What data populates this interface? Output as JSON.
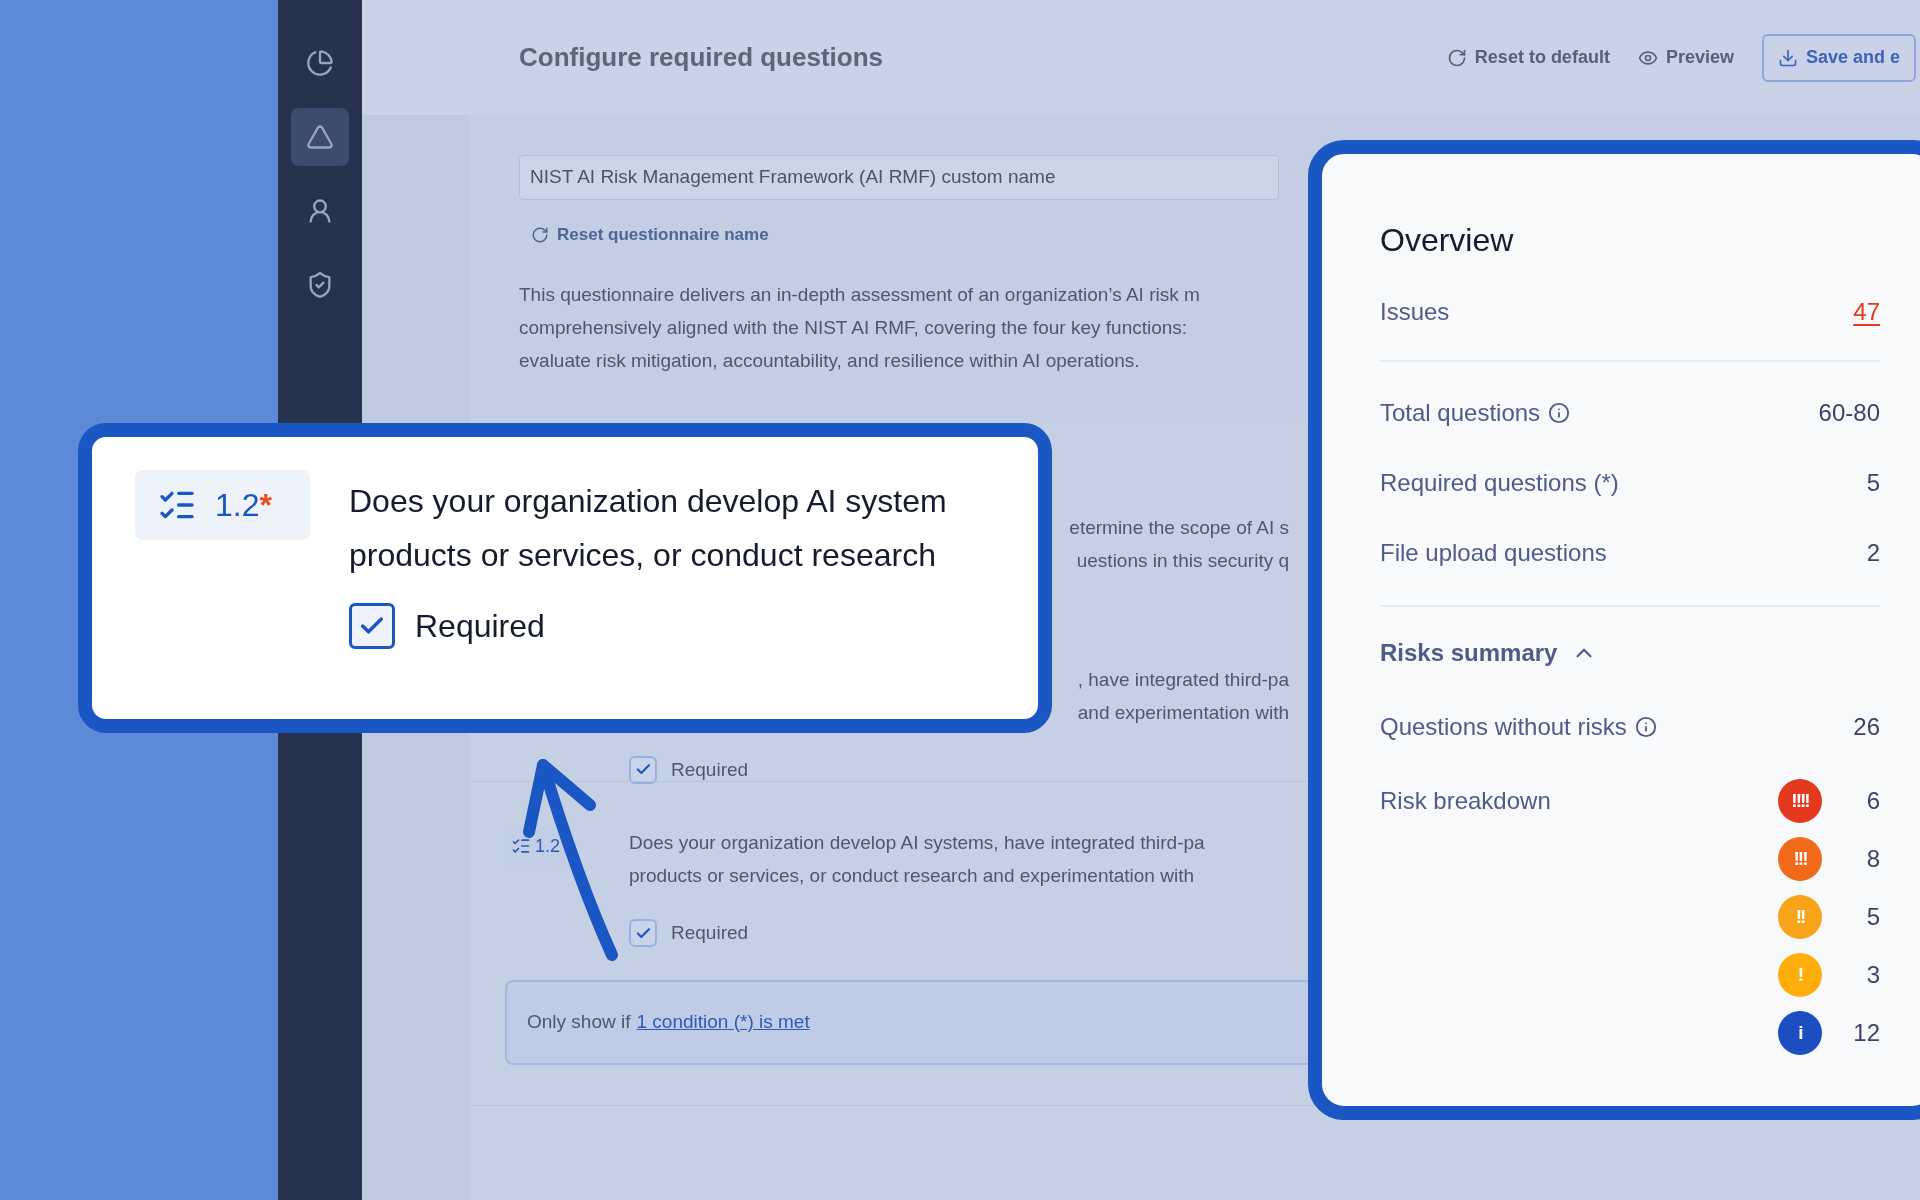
{
  "sidebar": {
    "items": [
      {
        "kind": "chart",
        "selected": false
      },
      {
        "kind": "triangle",
        "selected": true
      },
      {
        "kind": "person",
        "selected": false
      },
      {
        "kind": "shield",
        "selected": false
      }
    ]
  },
  "header": {
    "title": "Configure required questions",
    "actions": [
      {
        "kind": "reset",
        "label": "Reset to default"
      },
      {
        "kind": "preview",
        "label": "Preview"
      },
      {
        "kind": "save",
        "label": "Save and e"
      }
    ]
  },
  "form": {
    "name_field": {
      "value": "NIST AI Risk Management Framework (AI RMF) custom name"
    },
    "reset_link": "Reset questionnaire name",
    "description_lines": [
      "This questionnaire delivers an in-depth assessment of an organization’s AI risk m",
      "comprehensively aligned with the NIST AI RMF, covering the four key functions:",
      "evaluate risk mitigation, accountability, and resilience within AI operations."
    ]
  },
  "questions": [
    {
      "kind": "partial",
      "lines": [
        "etermine the scope of AI s",
        "uestions in this security q"
      ]
    },
    {
      "kind": "partial",
      "lines": [
        ", have integrated third-pa",
        "and experimentation with"
      ],
      "required": {
        "label": "Required",
        "checked": true
      }
    },
    {
      "kind": "full",
      "number": "1.2",
      "lines": [
        "Does your organization develop AI systems, have integrated third-pa",
        "products or services, or conduct research and experimentation with"
      ],
      "required": {
        "label": "Required",
        "checked": true
      }
    }
  ],
  "condition": {
    "prefix": "Only show if",
    "link": "1 condition (*) is met"
  },
  "callout": {
    "number": "1.2",
    "required_mark": "*",
    "lines": [
      "Does your organization develop AI system",
      "products or services, or conduct research"
    ],
    "required": {
      "label": "Required",
      "checked": true
    }
  },
  "overview": {
    "title": "Overview",
    "issues": {
      "label": "Issues",
      "value": "47"
    },
    "stats": [
      {
        "label": "Total questions",
        "value": "60-80",
        "info": true
      },
      {
        "label": "Required questions (*)",
        "value": "5",
        "info": false
      },
      {
        "label": "File upload questions",
        "value": "2",
        "info": false
      }
    ],
    "risks_summary": {
      "title": "Risks summary",
      "expanded": true,
      "without_risks": {
        "label": "Questions without risks",
        "value": "26",
        "info": true
      },
      "breakdown_label": "Risk breakdown",
      "levels": [
        {
          "symbol": "!!!!",
          "count": "6",
          "color": "#e5391f"
        },
        {
          "symbol": "!!!",
          "count": "8",
          "color": "#f06a1a"
        },
        {
          "symbol": "!!",
          "count": "5",
          "color": "#f8a41a"
        },
        {
          "symbol": "!",
          "count": "3",
          "color": "#ffad0a"
        },
        {
          "symbol": "i",
          "count": "12",
          "color": "#1b4fc0"
        }
      ]
    }
  }
}
